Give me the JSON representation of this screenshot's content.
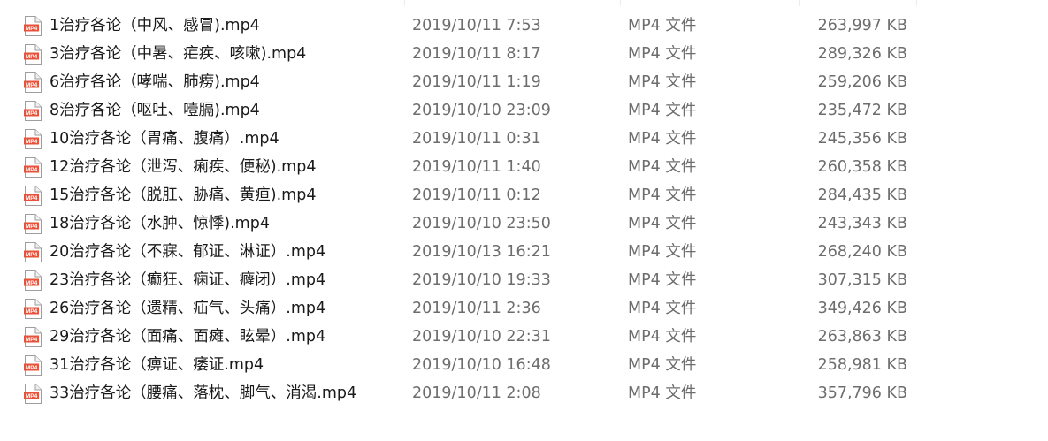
{
  "icon": {
    "name": "mp4-file-icon",
    "label": "MP4",
    "accent": "#e5533c"
  },
  "files": [
    {
      "name": "1治疗各论（中风、感冒).mp4",
      "date": "2019/10/11 7:53",
      "type": "MP4 文件",
      "size": "263,997 KB"
    },
    {
      "name": "3治疗各论（中暑、疟疾、咳嗽).mp4",
      "date": "2019/10/11 8:17",
      "type": "MP4 文件",
      "size": "289,326 KB"
    },
    {
      "name": "6治疗各论（哮喘、肺痨).mp4",
      "date": "2019/10/11 1:19",
      "type": "MP4 文件",
      "size": "259,206 KB"
    },
    {
      "name": "8治疗各论（呕吐、噎膈).mp4",
      "date": "2019/10/10 23:09",
      "type": "MP4 文件",
      "size": "235,472 KB"
    },
    {
      "name": "10治疗各论（胃痛、腹痛）.mp4",
      "date": "2019/10/11 0:31",
      "type": "MP4 文件",
      "size": "245,356 KB"
    },
    {
      "name": "12治疗各论（泄泻、痢疾、便秘).mp4",
      "date": "2019/10/11 1:40",
      "type": "MP4 文件",
      "size": "260,358 KB"
    },
    {
      "name": "15治疗各论（脱肛、胁痛、黄疸).mp4",
      "date": "2019/10/11 0:12",
      "type": "MP4 文件",
      "size": "284,435 KB"
    },
    {
      "name": "18治疗各论（水肿、惊悸).mp4",
      "date": "2019/10/10 23:50",
      "type": "MP4 文件",
      "size": "243,343 KB"
    },
    {
      "name": "20治疗各论（不寐、郁证、淋证）.mp4",
      "date": "2019/10/13 16:21",
      "type": "MP4 文件",
      "size": "268,240 KB"
    },
    {
      "name": "23治疗各论（癫狂、痫证、癃闭）.mp4",
      "date": "2019/10/10 19:33",
      "type": "MP4 文件",
      "size": "307,315 KB"
    },
    {
      "name": "26治疗各论（遗精、疝气、头痛）.mp4",
      "date": "2019/10/11 2:36",
      "type": "MP4 文件",
      "size": "349,426 KB"
    },
    {
      "name": "29治疗各论（面痛、面瘫、眩晕）.mp4",
      "date": "2019/10/10 22:31",
      "type": "MP4 文件",
      "size": "263,863 KB"
    },
    {
      "name": "31治疗各论（痹证、痿证.mp4",
      "date": "2019/10/10 16:48",
      "type": "MP4 文件",
      "size": "258,981 KB"
    },
    {
      "name": "33治疗各论（腰痛、落枕、脚气、消渴.mp4",
      "date": "2019/10/11 2:08",
      "type": "MP4 文件",
      "size": "357,796 KB"
    }
  ]
}
